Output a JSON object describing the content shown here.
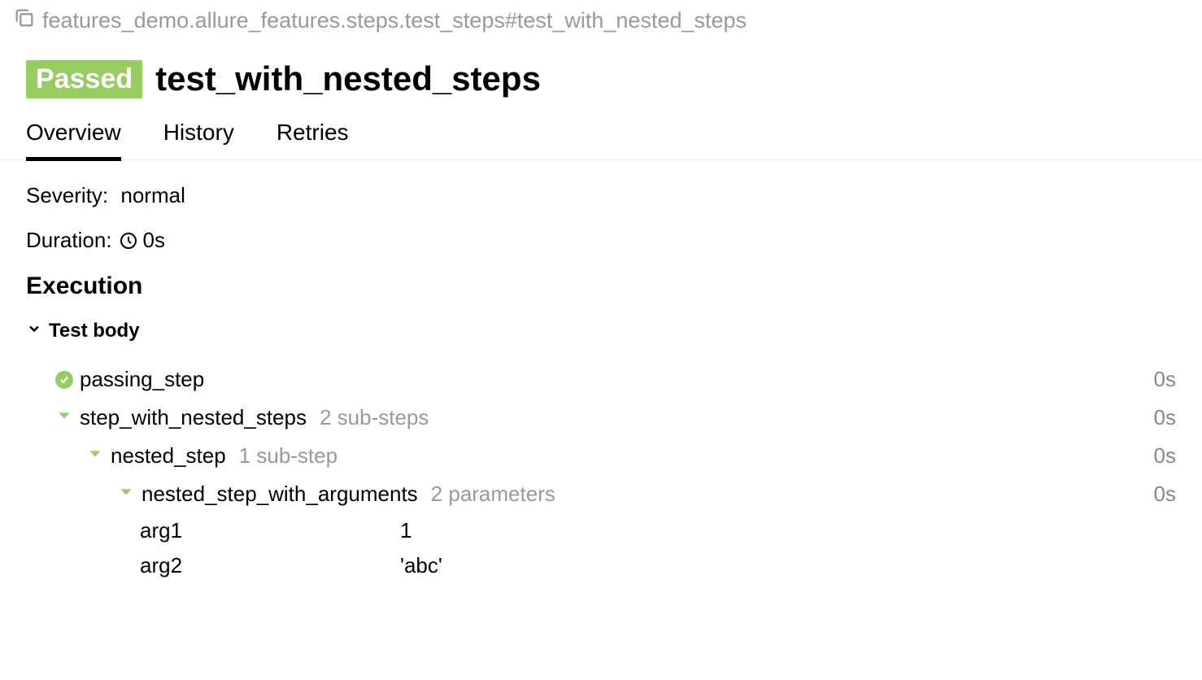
{
  "breadcrumb": "features_demo.allure_features.steps.test_steps#test_with_nested_steps",
  "status": "Passed",
  "title": "test_with_nested_steps",
  "tabs": [
    "Overview",
    "History",
    "Retries"
  ],
  "activeTab": 0,
  "meta": {
    "severity_label": "Severity:",
    "severity_value": "normal",
    "duration_label": "Duration:",
    "duration_value": "0s"
  },
  "execution_heading": "Execution",
  "test_body_label": "Test body",
  "steps": {
    "passing_step": {
      "name": "passing_step",
      "duration": "0s"
    },
    "step_with_nested": {
      "name": "step_with_nested_steps",
      "hint": "2 sub-steps",
      "duration": "0s"
    },
    "nested_step": {
      "name": "nested_step",
      "hint": "1 sub-step",
      "duration": "0s"
    },
    "nested_step_args": {
      "name": "nested_step_with_arguments",
      "hint": "2 parameters",
      "duration": "0s"
    }
  },
  "params": [
    {
      "name": "arg1",
      "value": "1"
    },
    {
      "name": "arg2",
      "value": "'abc'"
    }
  ]
}
